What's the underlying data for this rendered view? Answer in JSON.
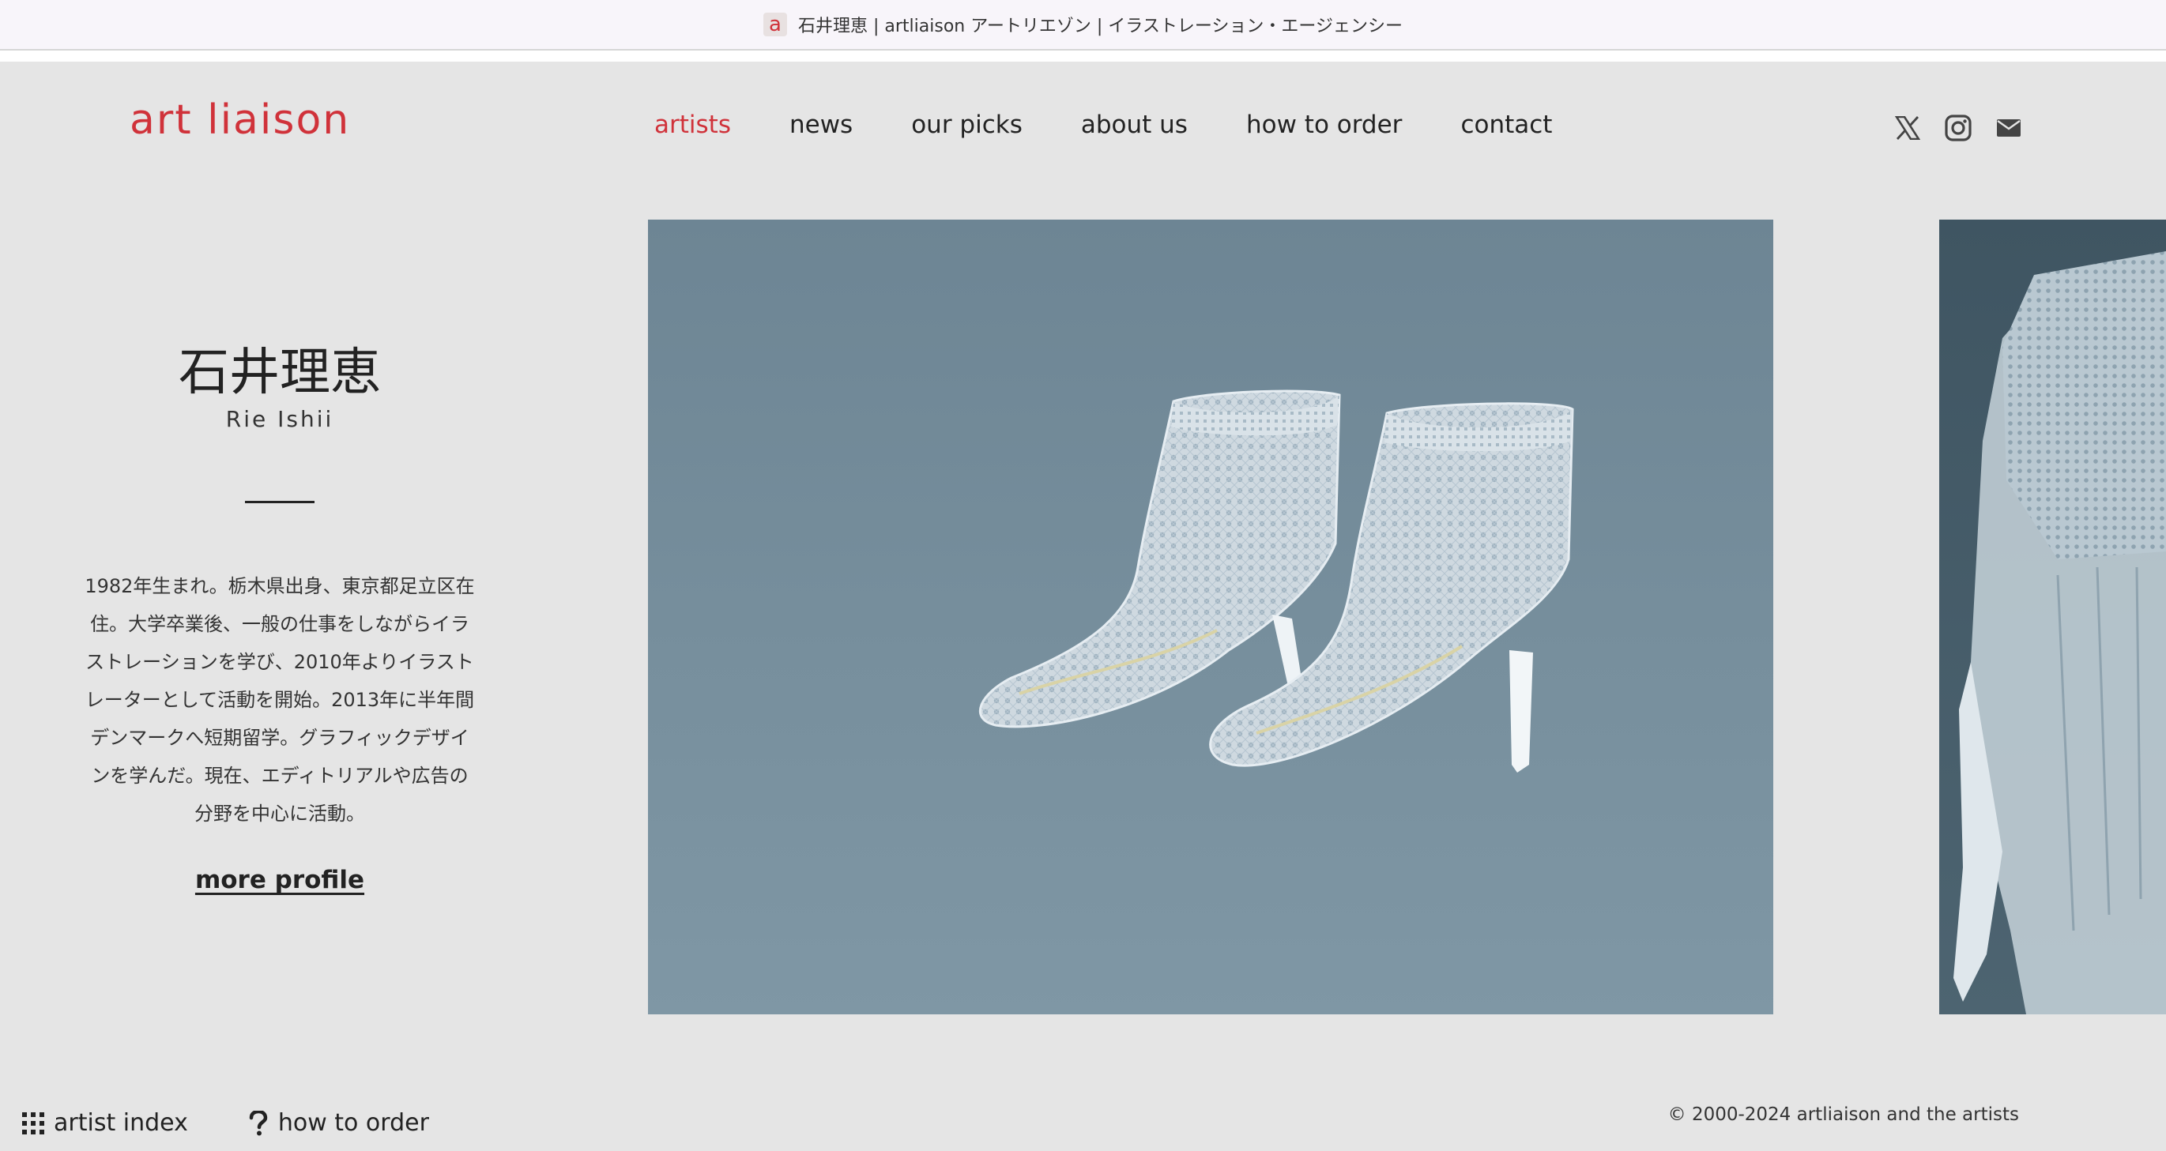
{
  "browser": {
    "favicon_letter": "a",
    "tab_title": "石井理恵 | artliaison アートリエゾン | イラストレーション・エージェンシー"
  },
  "header": {
    "logo": "art liaison",
    "nav": [
      {
        "label": "artists",
        "active": true
      },
      {
        "label": "news",
        "active": false
      },
      {
        "label": "our picks",
        "active": false
      },
      {
        "label": "about us",
        "active": false
      },
      {
        "label": "how to order",
        "active": false
      },
      {
        "label": "contact",
        "active": false
      }
    ],
    "social_icons": [
      "x-icon",
      "instagram-icon",
      "mail-icon"
    ],
    "accent_color": "#d0323a"
  },
  "artist": {
    "name_jp": "石井理恵",
    "name_en": "Rie Ishii",
    "bio": "1982年生まれ。栃木県出身、東京都足立区在住。大学卒業後、一般の仕事をしながらイラストレーションを学び、2010年よりイラストレーターとして活動を開始。2013年に半年間デンマークへ短期留学。グラフィックデザインを学んだ。現在、エディトリアルや広告の分野を中心に活動。",
    "more_profile": "more profile"
  },
  "gallery": {
    "main_artwork": "lace-ankle-boots-illustration",
    "next_artwork": "lace-blouse-illustration"
  },
  "footer": {
    "artist_index": "artist index",
    "how_to_order": "how to order",
    "copyright": "© 2000-2024 artliaison and the artists"
  }
}
